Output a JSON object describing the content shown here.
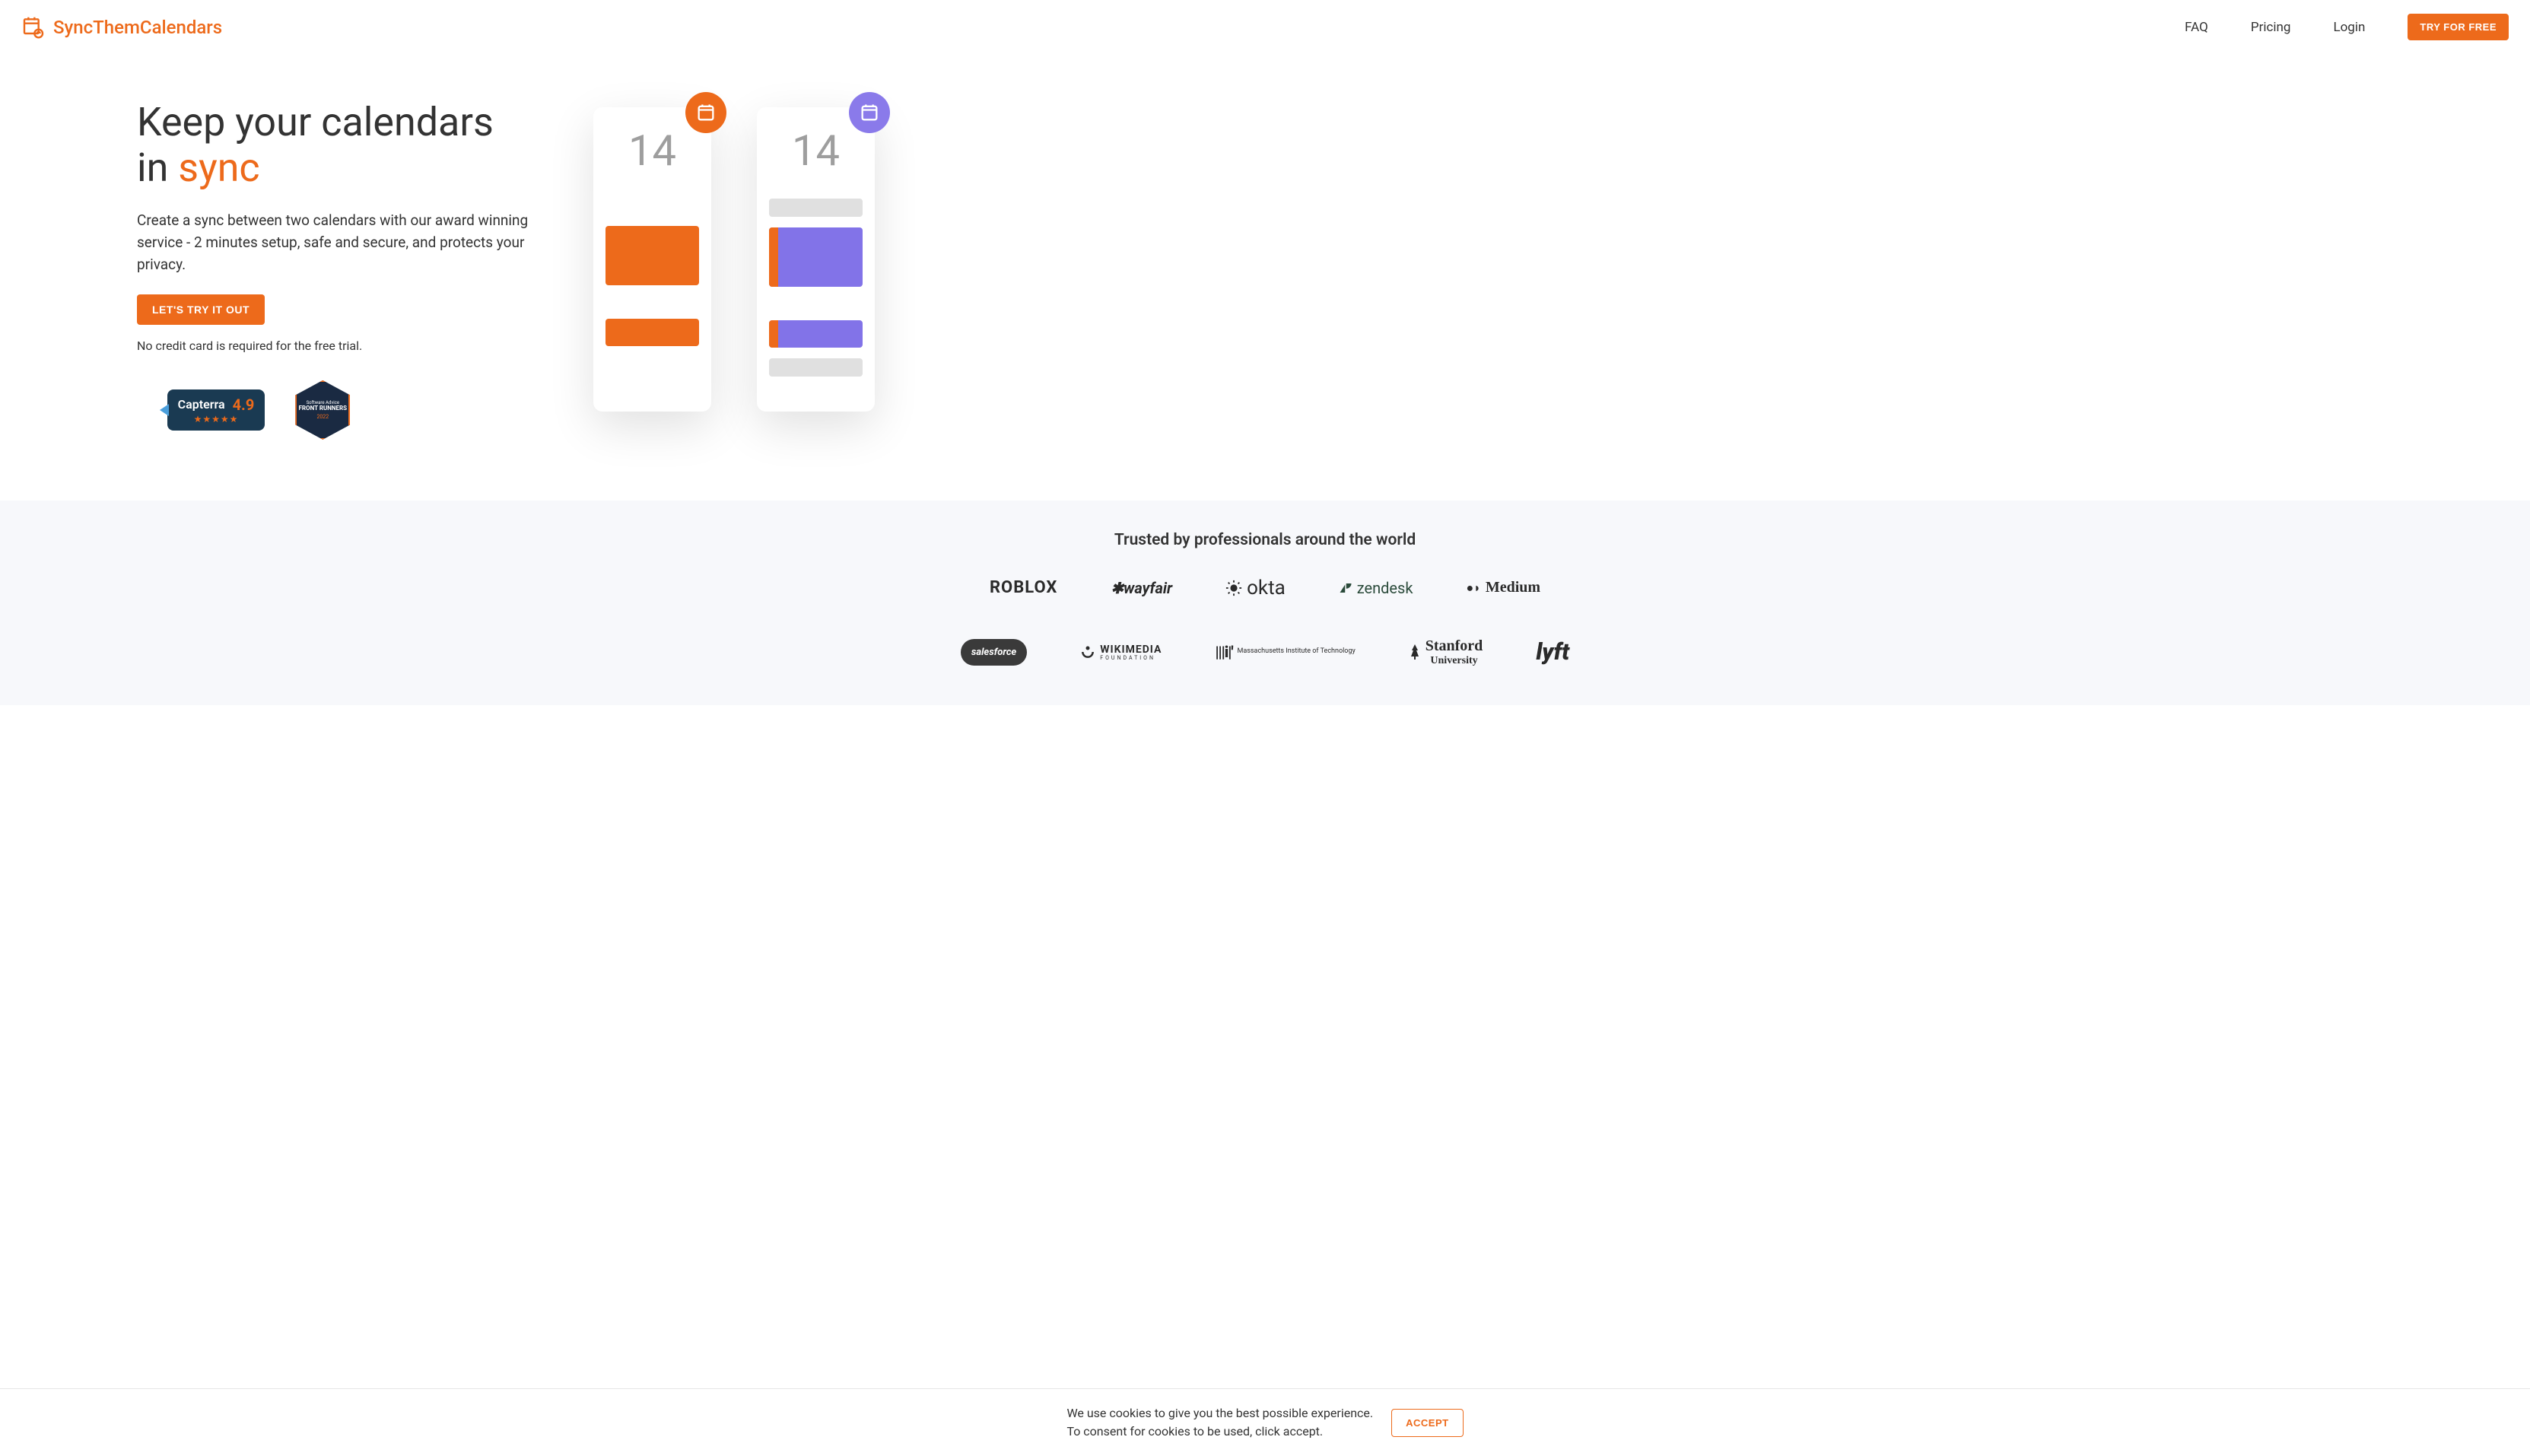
{
  "brand": {
    "name": "SyncThemCalendars"
  },
  "nav": {
    "faq": "FAQ",
    "pricing": "Pricing",
    "login": "Login",
    "cta": "TRY FOR FREE"
  },
  "hero": {
    "title_line1": "Keep your calendars",
    "title_line2_prefix": "in ",
    "title_line2_accent": "sync",
    "description": "Create a sync between two calendars with our award winning service - 2 minutes setup, safe and secure, and protects your privacy.",
    "cta": "LET'S TRY IT OUT",
    "note": "No credit card is required for the free trial.",
    "badges": {
      "capterra_name": "Capterra",
      "capterra_score": "4.9",
      "capterra_stars": "★★★★★",
      "sa_label": "Software Advice",
      "sa_title": "FRONT RUNNERS",
      "sa_year": "2022"
    },
    "cal": {
      "day_left": "14",
      "day_right": "14"
    }
  },
  "trusted": {
    "title": "Trusted by professionals around the world",
    "logos": {
      "roblox": "ROBLOX",
      "wayfair": "✱wayfair",
      "okta": "okta",
      "zendesk": "zendesk",
      "medium": "Medium",
      "salesforce": "salesforce",
      "wikimedia": "WIKIMEDIA",
      "wikimedia_sub": "FOUNDATION",
      "mit": "MIT",
      "mit_sub": "Massachusetts Institute of Technology",
      "stanford": "Stanford",
      "stanford_sub": "University",
      "lyft": "lyft"
    }
  },
  "cookie": {
    "line1": "We use cookies to give you the best possible experience.",
    "line2": "To consent for cookies to be used, click accept.",
    "accept": "ACCEPT"
  }
}
